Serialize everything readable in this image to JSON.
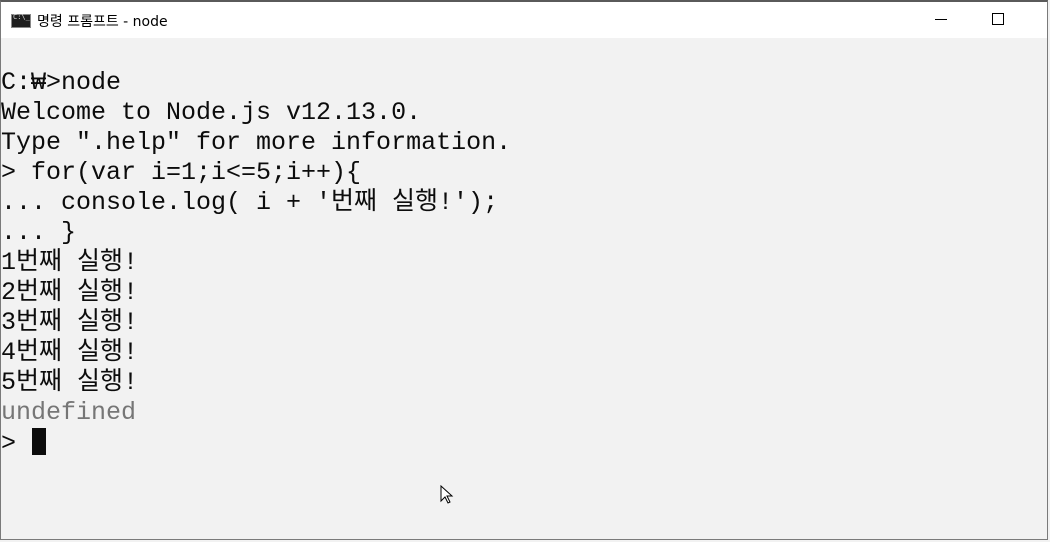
{
  "window": {
    "title": "명령 프롬프트 - node",
    "icon": "cmd-icon"
  },
  "terminal": {
    "lines": [
      "C:₩>node",
      "Welcome to Node.js v12.13.0.",
      "Type \".help\" for more information.",
      "> for(var i=1;i<=5;i++){",
      "... console.log( i + '번째 실행!');",
      "... }",
      "1번째 실행!",
      "2번째 실행!",
      "3번째 실행!",
      "4번째 실행!",
      "5번째 실행!"
    ],
    "result": "undefined",
    "prompt": ">"
  }
}
